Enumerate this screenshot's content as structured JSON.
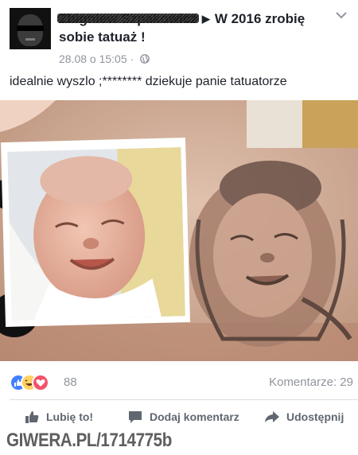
{
  "post": {
    "author_name": "Zbigniew Szpakowicz",
    "title": "W 2016 zrobię sobie tatuaż !",
    "timestamp": "28.08 o 15:05",
    "separator": "·",
    "privacy_icon": "globe-icon",
    "text": "idealnie wyszlo ;******** dziekuje panie tatuatorze"
  },
  "reactions": {
    "icons": [
      "like-icon",
      "haha-icon",
      "love-icon"
    ],
    "count": "88",
    "comments": "Komentarze: 29"
  },
  "actions": {
    "like": "Lubię to!",
    "comment": "Dodaj komentarz",
    "share": "Udostępnij"
  },
  "watermark": "GIWERA.PL/1714775b",
  "colors": {
    "text": "#1d2129",
    "muted": "#90949c",
    "action": "#606770",
    "like": "#4080ff",
    "haha": "#ffd15f",
    "love": "#f25268"
  }
}
